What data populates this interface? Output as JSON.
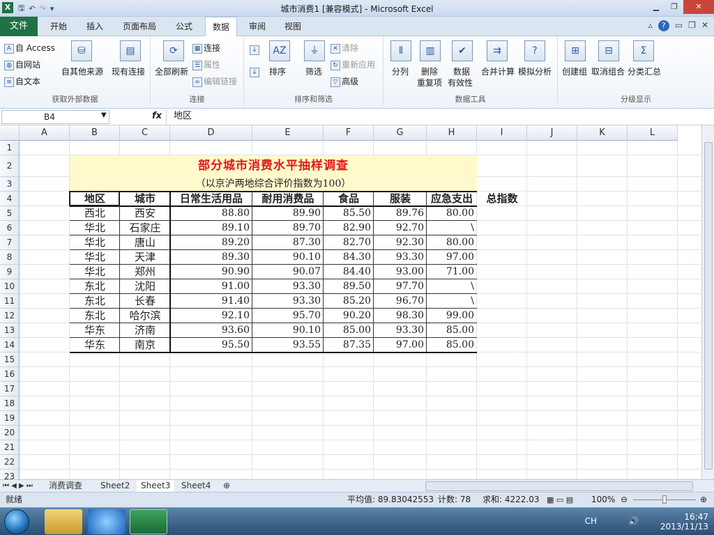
{
  "window": {
    "title": "城市消费1  [兼容模式]  -  Microsoft Excel",
    "min": "▁",
    "restore": "❐",
    "close": "✕"
  },
  "menu": {
    "file": "文件",
    "tabs": [
      "开始",
      "插入",
      "页面布局",
      "公式",
      "数据",
      "审阅",
      "视图"
    ],
    "active": "数据"
  },
  "ribbon": {
    "g1": {
      "label": "获取外部数据",
      "access": "自 Access",
      "web": "自网站",
      "text": "自文本",
      "other": "自其他来源",
      "existing": "现有连接"
    },
    "g2": {
      "label": "连接",
      "refresh": "全部刷新",
      "conn": "连接",
      "prop": "属性",
      "edit": "编辑链接"
    },
    "g3": {
      "label": "排序和筛选",
      "sort": "排序",
      "filter": "筛选",
      "clear": "清除",
      "reapply": "重新应用",
      "adv": "高级"
    },
    "g4": {
      "label": "数据工具",
      "split": "分列",
      "dedup1": "删除",
      "dedup2": "重复项",
      "valid1": "数据",
      "valid2": "有效性",
      "consol": "合并计算",
      "whatif": "模拟分析"
    },
    "g5": {
      "label": "分级显示",
      "group": "创建组",
      "ungroup": "取消组合",
      "subtotal": "分类汇总"
    }
  },
  "formula": {
    "namebox": "B4",
    "fx": "fx",
    "content": "地区"
  },
  "columns": [
    "A",
    "B",
    "C",
    "D",
    "E",
    "F",
    "G",
    "H",
    "I",
    "J",
    "K",
    "L"
  ],
  "rows": [
    "1",
    "2",
    "3",
    "4",
    "5",
    "6",
    "7",
    "8",
    "9",
    "10",
    "11",
    "12",
    "13",
    "14",
    "15",
    "16",
    "17",
    "18",
    "19",
    "20",
    "21",
    "22",
    "23"
  ],
  "sheet": {
    "title": "部分城市消费水平抽样调查",
    "subtitle": "（以京沪两地综合评价指数为100）",
    "headers": [
      "地区",
      "城市",
      "日常生活用品",
      "耐用消费品",
      "食品",
      "服装",
      "应急支出",
      "总指数"
    ],
    "data": [
      [
        "西北",
        "西安",
        "88.80",
        "89.90",
        "85.50",
        "89.76",
        "80.00",
        ""
      ],
      [
        "华北",
        "石家庄",
        "89.10",
        "89.70",
        "82.90",
        "92.70",
        "\\",
        ""
      ],
      [
        "华北",
        "唐山",
        "89.20",
        "87.30",
        "82.70",
        "92.30",
        "80.00",
        ""
      ],
      [
        "华北",
        "天津",
        "89.30",
        "90.10",
        "84.30",
        "93.30",
        "97.00",
        ""
      ],
      [
        "华北",
        "郑州",
        "90.90",
        "90.07",
        "84.40",
        "93.00",
        "71.00",
        ""
      ],
      [
        "东北",
        "沈阳",
        "91.00",
        "93.30",
        "89.50",
        "97.70",
        "\\",
        ""
      ],
      [
        "东北",
        "长春",
        "91.40",
        "93.30",
        "85.20",
        "96.70",
        "\\",
        ""
      ],
      [
        "东北",
        "哈尔滨",
        "92.10",
        "95.70",
        "90.20",
        "98.30",
        "99.00",
        ""
      ],
      [
        "华东",
        "济南",
        "93.60",
        "90.10",
        "85.00",
        "93.30",
        "85.00",
        ""
      ],
      [
        "华东",
        "南京",
        "95.50",
        "93.55",
        "87.35",
        "97.00",
        "85.00",
        ""
      ]
    ]
  },
  "sheet_tabs": [
    "消费调查",
    "Sheet2",
    "Sheet3",
    "Sheet4"
  ],
  "active_sheet": "Sheet3",
  "status": {
    "ready": "就绪",
    "avg": "平均值: 89.83042553",
    "count": "计数: 78",
    "sum": "求和: 4222.03",
    "zoom": "100%"
  },
  "taskbar": {
    "lang": "CH",
    "time": "16:47",
    "date": "2013/11/13"
  }
}
